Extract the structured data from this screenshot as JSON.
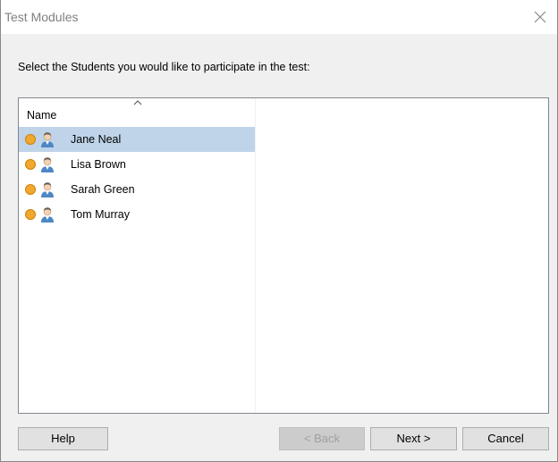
{
  "window": {
    "title": "Test Modules"
  },
  "instruction": "Select the Students you would like to participate in the test:",
  "list": {
    "column_header": "Name",
    "sort": "ascending",
    "selected_index": 0,
    "items": [
      {
        "label": "Jane Neal",
        "status_color": "#f0a830",
        "icon": "student-icon"
      },
      {
        "label": "Lisa Brown",
        "status_color": "#f0a830",
        "icon": "student-icon"
      },
      {
        "label": "Sarah Green",
        "status_color": "#f0a830",
        "icon": "student-icon"
      },
      {
        "label": "Tom Murray",
        "status_color": "#f0a830",
        "icon": "student-icon"
      }
    ]
  },
  "buttons": {
    "help": "Help",
    "back": "< Back",
    "next": "Next >",
    "cancel": "Cancel"
  },
  "colors": {
    "selection": "#bfd3e9",
    "status_dot": "#f0a830"
  }
}
